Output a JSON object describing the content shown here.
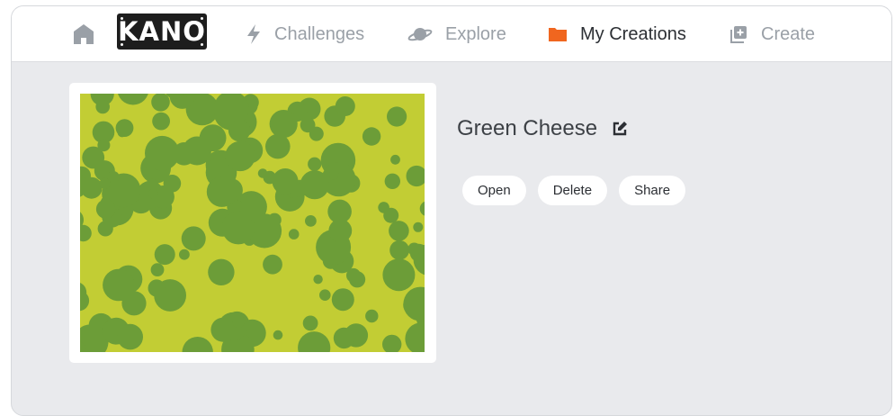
{
  "nav": {
    "logo": "KANO",
    "items": [
      {
        "label": "Challenges",
        "icon": "lightning-icon",
        "active": false
      },
      {
        "label": "Explore",
        "icon": "planet-icon",
        "active": false
      },
      {
        "label": "My Creations",
        "icon": "folder-icon",
        "active": true
      },
      {
        "label": "Create",
        "icon": "add-square-icon",
        "active": false
      }
    ]
  },
  "creation": {
    "title": "Green Cheese",
    "actions": {
      "open": "Open",
      "delete": "Delete",
      "share": "Share"
    }
  },
  "colors": {
    "accent": "#f0661f",
    "thumbnail_background": "#c2cd34",
    "thumbnail_blobs": "#6c9d38"
  }
}
